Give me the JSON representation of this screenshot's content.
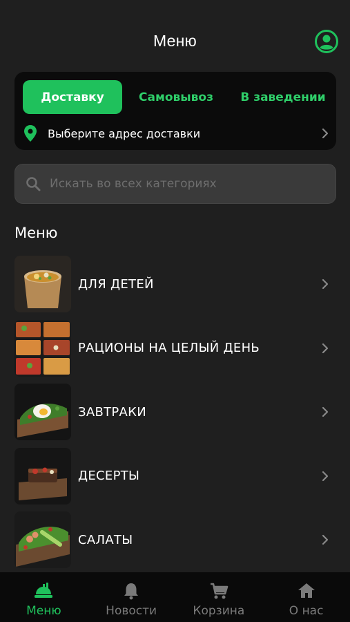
{
  "header": {
    "title": "Меню"
  },
  "delivery": {
    "tabs": [
      {
        "label": "Доставку",
        "active": true
      },
      {
        "label": "Самовывоз",
        "active": false
      },
      {
        "label": "В заведении",
        "active": false
      }
    ],
    "address_prompt": "Выберите адрес доставки"
  },
  "search": {
    "placeholder": "Искать во всех категориях"
  },
  "menu": {
    "title": "Меню",
    "categories": [
      {
        "label": "ДЛЯ ДЕТЕЙ"
      },
      {
        "label": "РАЦИОНЫ НА ЦЕЛЫЙ ДЕНЬ"
      },
      {
        "label": "ЗАВТРАКИ"
      },
      {
        "label": "ДЕСЕРТЫ"
      },
      {
        "label": "САЛАТЫ"
      }
    ]
  },
  "tabbar": {
    "items": [
      {
        "label": "Меню",
        "icon": "menu-food-icon",
        "active": true
      },
      {
        "label": "Новости",
        "icon": "bell-icon",
        "active": false
      },
      {
        "label": "Корзина",
        "icon": "cart-icon",
        "active": false
      },
      {
        "label": "О нас",
        "icon": "home-icon",
        "active": false
      }
    ]
  },
  "colors": {
    "accent": "#1fc15c",
    "background": "#1f1f1f",
    "card": "#0b0b0b"
  }
}
